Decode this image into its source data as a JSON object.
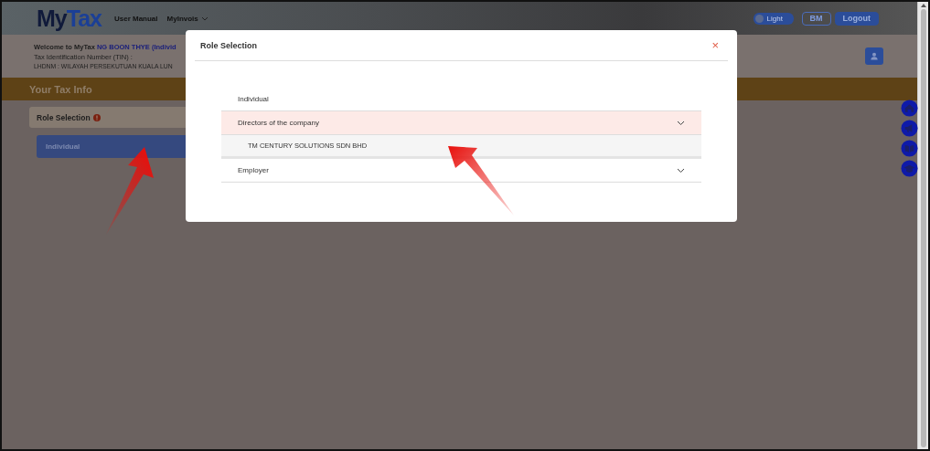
{
  "header": {
    "logo": {
      "first": "My",
      "second": "Tax"
    },
    "nav": [
      {
        "label": "User Manual",
        "has_dropdown": false
      },
      {
        "label": "MyInvois",
        "has_dropdown": true
      }
    ],
    "theme_toggle": {
      "label": "Light",
      "on": false
    },
    "buttons": [
      {
        "label": "BM",
        "kind": "outline"
      },
      {
        "label": "Logout",
        "kind": "filled"
      }
    ]
  },
  "info": {
    "welcome": "Welcome to MyTax",
    "user_name": "NG BOON THYE (Individ",
    "tin_label": "Tax Identification Number (TIN) :",
    "office": "LHDNM : WILAYAH PERSEKUTUAN KUALA LUN"
  },
  "banner": {
    "title": "Your Tax Info"
  },
  "role_panel": {
    "title": "Role Selection",
    "roles": [
      {
        "label": "Individual",
        "selected": true
      }
    ]
  },
  "modal": {
    "title": "Role Selection",
    "close": "×",
    "items": [
      {
        "label": "Individual",
        "kind": "plain",
        "selected": false
      },
      {
        "label": "Directors of the company",
        "kind": "group",
        "selected": true,
        "expanded": true,
        "children": [
          {
            "label": "TM CENTURY SOLUTIONS SDN BHD"
          }
        ]
      },
      {
        "label": "Employer",
        "kind": "group",
        "selected": false,
        "expanded": false
      }
    ]
  }
}
